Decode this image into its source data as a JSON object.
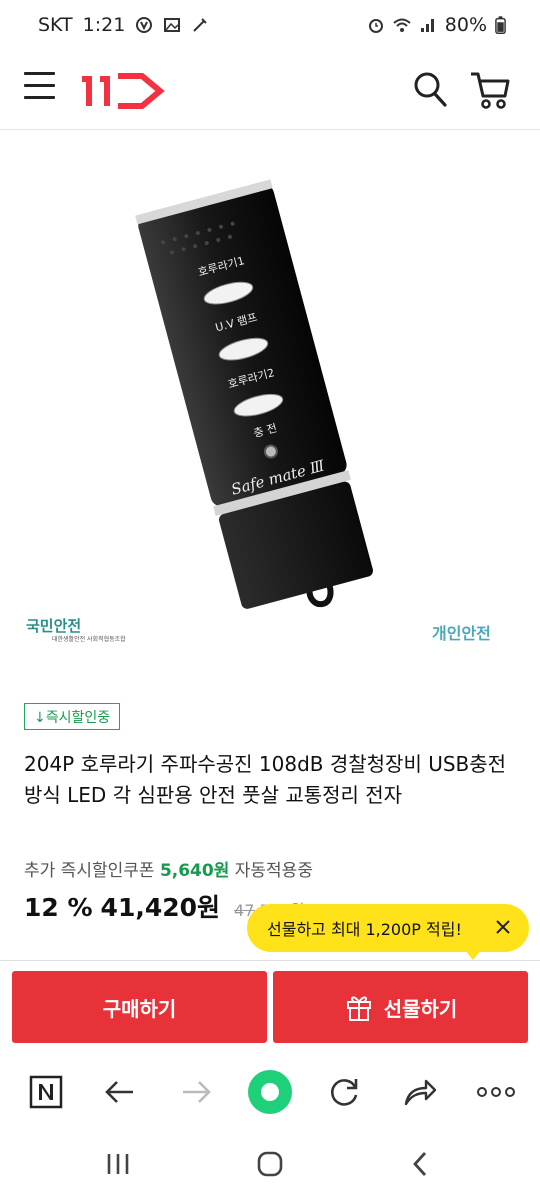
{
  "status_bar": {
    "carrier": "SKT",
    "time": "1:21",
    "battery": "80%"
  },
  "header": {
    "logo_text": "11",
    "icons": [
      "menu-icon",
      "search-icon",
      "cart-icon"
    ]
  },
  "product": {
    "device_labels": {
      "btn1": "호루라기1",
      "btn2": "U.V 램프",
      "btn3": "호루라기2",
      "charge": "충 전",
      "brand": "Safe mate Ⅲ"
    },
    "watermark_left": "국민안전",
    "watermark_left_sub": "대한생활안전\n사회적협동조합",
    "watermark_right": "개인안전",
    "badge": "↓즉시할인중",
    "title": "204P 호루라기 주파수공진 108dB 경찰청장비 USB충전방식 LED 각 심판용 안전 풋살 교통정리 전자",
    "coupon_prefix": "추가 즉시할인쿠폰 ",
    "coupon_amount": "5,640원",
    "coupon_suffix": " 자동적용중",
    "discount": "12 %",
    "price": "41,420원",
    "original_price": "47,520원"
  },
  "tooltip": {
    "text": "선물하고 최대 1,200P 적립!"
  },
  "actions": {
    "buy_label": "구매하기",
    "gift_label": "선물하기"
  },
  "browser_toolbar": [
    "naver-n-icon",
    "back-arrow-icon",
    "forward-arrow-icon",
    "home-green-icon",
    "refresh-icon",
    "share-icon",
    "more-icon"
  ],
  "colors": {
    "brand_red": "#e8323a",
    "green": "#159a4e",
    "tooltip_yellow": "#ffe21a"
  }
}
